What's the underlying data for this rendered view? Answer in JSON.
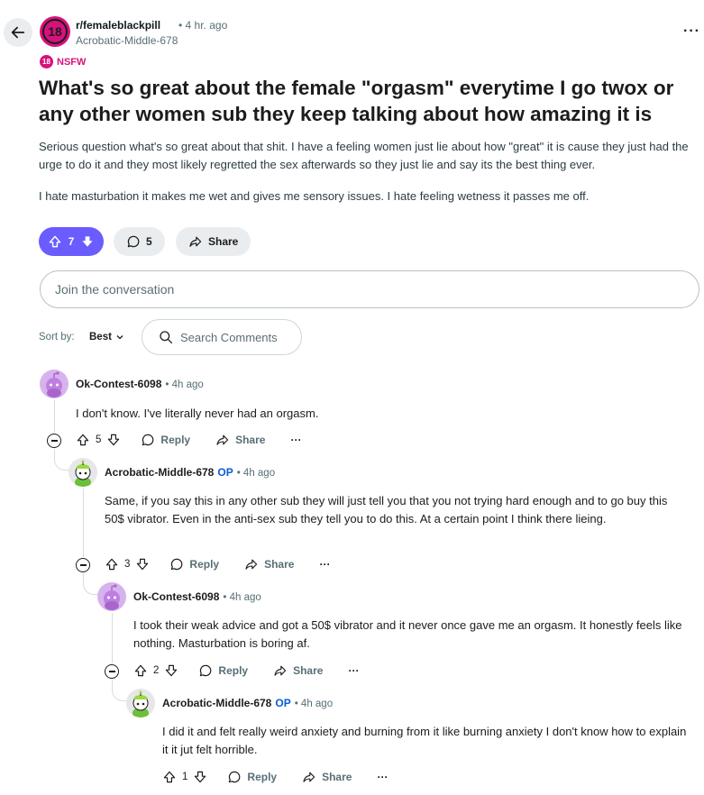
{
  "post": {
    "subreddit": "r/femaleblackpill",
    "subreddit_avatar": "18",
    "time": "• 4 hr. ago",
    "author": "Acrobatic-Middle-678",
    "nsfw_badge": "18",
    "nsfw_label": "NSFW",
    "title": "What's so great about the female \"orgasm\" everytime I go twox or any other women sub they keep talking about how amazing it is",
    "body": [
      "Serious question what's so great about that shit. I have a feeling women just lie about how \"great\" it is cause they just had the urge to do it and they most likely regretted the sex afterwards so they just lie and say its the best thing ever.",
      "I hate masturbation it makes me wet and gives me sensory issues. I hate feeling wetness it passes me off."
    ],
    "votes": "7",
    "comments_count": "5",
    "share_label": "Share"
  },
  "join_placeholder": "Join the conversation",
  "sort": {
    "label": "Sort by:",
    "value": "Best"
  },
  "search_placeholder": "Search Comments",
  "comments": [
    {
      "author": "Ok-Contest-6098",
      "op": "",
      "time": "• 4h ago",
      "body": "I don't know. I've literally never had an orgasm.",
      "votes": "5"
    },
    {
      "author": "Acrobatic-Middle-678",
      "op": "OP",
      "time": "• 4h ago",
      "body": "Same, if you say this in any other sub they will just tell you that you not trying hard enough and to go buy this 50$ vibrator. Even in the anti-sex sub they tell you to do this. At a certain point I think there lieing.",
      "votes": "3"
    },
    {
      "author": "Ok-Contest-6098",
      "op": "",
      "time": "• 4h ago",
      "body": "I took their weak advice and got a 50$ vibrator and it never once gave me an orgasm. It honestly feels like nothing. Masturbation is boring af.",
      "votes": "2"
    },
    {
      "author": "Acrobatic-Middle-678",
      "op": "OP",
      "time": "• 4h ago",
      "body": "I did it and felt really weird anxiety and burning from it like burning anxiety I don't know how to explain it it jut felt horrible.",
      "votes": "1"
    }
  ],
  "actions": {
    "reply": "Reply",
    "share": "Share",
    "more": "···"
  },
  "colors": {
    "upvote_active": "#6a5cff",
    "nsfw": "#d6127c",
    "op": "#0a5cd6",
    "pill_bg": "#eaedef"
  },
  "icons": [
    "back-arrow-icon",
    "more-icon",
    "upvote-icon",
    "downvote-icon",
    "comment-icon",
    "share-icon",
    "search-icon",
    "chevron-down-icon",
    "collapse-icon",
    "snoo-avatar-icon"
  ]
}
